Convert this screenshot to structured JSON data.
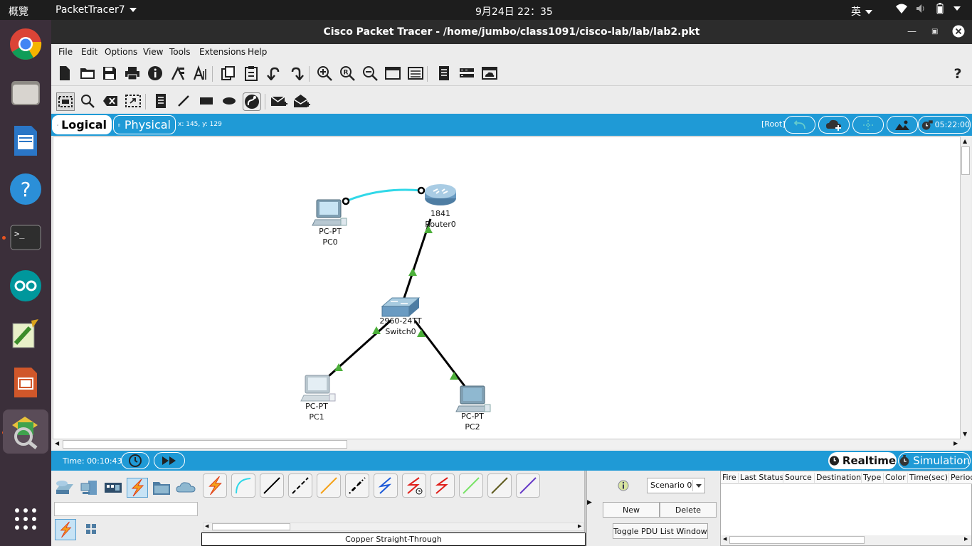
{
  "system_bar": {
    "activities": "概覽",
    "app_name": "PacketTracer7",
    "clock": "9月24日 22：35",
    "ime": "英"
  },
  "window": {
    "title": "Cisco Packet Tracer - /home/jumbo/class1091/cisco-lab/lab/lab2.pkt"
  },
  "menu": [
    {
      "label": "File"
    },
    {
      "label": "Edit"
    },
    {
      "label": "Options"
    },
    {
      "label": "View"
    },
    {
      "label": "Tools"
    },
    {
      "label": "Extensions"
    },
    {
      "label": "Help"
    }
  ],
  "logical_bar": {
    "logical_label": "Logical",
    "physical_label": "Physical",
    "coords": "x: 145, y: 129",
    "root_label": "[Root]",
    "time": "05:22:00"
  },
  "devices": {
    "pc0": {
      "model": "PC-PT",
      "name": "PC0"
    },
    "router0": {
      "model": "1841",
      "name": "Router0"
    },
    "switch0": {
      "model": "2960-24TT",
      "name": "Switch0"
    },
    "pc1": {
      "model": "PC-PT",
      "name": "PC1"
    },
    "pc2": {
      "model": "PC-PT",
      "name": "PC2"
    }
  },
  "time_bar": {
    "time_label": "Time: 00:10:43",
    "realtime_label": "Realtime",
    "simulation_label": "Simulation"
  },
  "bottom": {
    "selected_cable_name": "Copper Straight-Through",
    "scenario": "Scenario 0",
    "new_label": "New",
    "delete_label": "Delete",
    "toggle_label": "Toggle PDU List Window",
    "pdu_columns": [
      "Fire",
      "Last Status",
      "Source",
      "Destination",
      "Type",
      "Color",
      "Time(sec)",
      "Periodic"
    ]
  },
  "colors": {
    "accent_blue": "#1f9ad6",
    "console_cable": "#30d8e8",
    "link_up": "#4caf3a"
  }
}
